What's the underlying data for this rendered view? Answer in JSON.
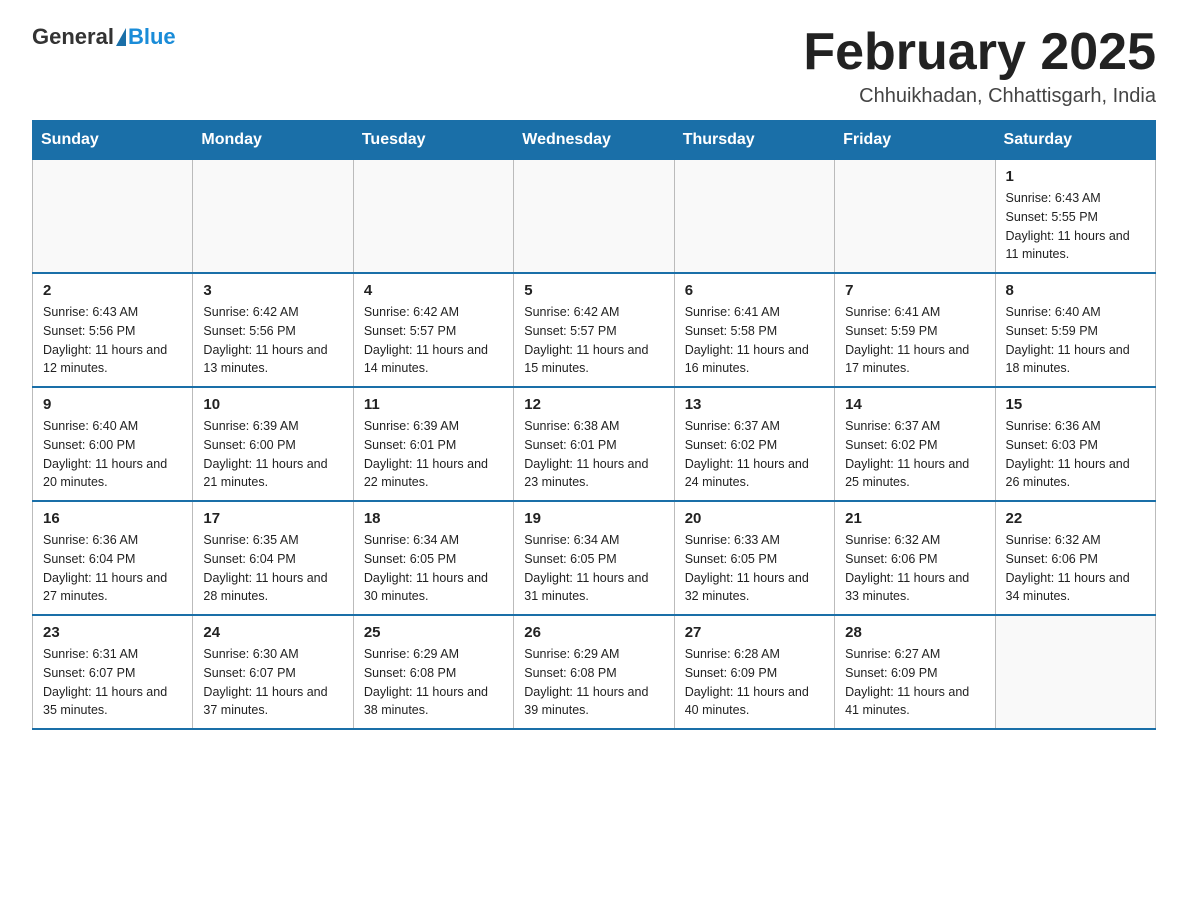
{
  "header": {
    "logo_general": "General",
    "logo_blue": "Blue",
    "month_title": "February 2025",
    "location": "Chhuikhadan, Chhattisgarh, India"
  },
  "days_of_week": [
    "Sunday",
    "Monday",
    "Tuesday",
    "Wednesday",
    "Thursday",
    "Friday",
    "Saturday"
  ],
  "weeks": [
    [
      {
        "day": "",
        "info": ""
      },
      {
        "day": "",
        "info": ""
      },
      {
        "day": "",
        "info": ""
      },
      {
        "day": "",
        "info": ""
      },
      {
        "day": "",
        "info": ""
      },
      {
        "day": "",
        "info": ""
      },
      {
        "day": "1",
        "info": "Sunrise: 6:43 AM\nSunset: 5:55 PM\nDaylight: 11 hours and 11 minutes."
      }
    ],
    [
      {
        "day": "2",
        "info": "Sunrise: 6:43 AM\nSunset: 5:56 PM\nDaylight: 11 hours and 12 minutes."
      },
      {
        "day": "3",
        "info": "Sunrise: 6:42 AM\nSunset: 5:56 PM\nDaylight: 11 hours and 13 minutes."
      },
      {
        "day": "4",
        "info": "Sunrise: 6:42 AM\nSunset: 5:57 PM\nDaylight: 11 hours and 14 minutes."
      },
      {
        "day": "5",
        "info": "Sunrise: 6:42 AM\nSunset: 5:57 PM\nDaylight: 11 hours and 15 minutes."
      },
      {
        "day": "6",
        "info": "Sunrise: 6:41 AM\nSunset: 5:58 PM\nDaylight: 11 hours and 16 minutes."
      },
      {
        "day": "7",
        "info": "Sunrise: 6:41 AM\nSunset: 5:59 PM\nDaylight: 11 hours and 17 minutes."
      },
      {
        "day": "8",
        "info": "Sunrise: 6:40 AM\nSunset: 5:59 PM\nDaylight: 11 hours and 18 minutes."
      }
    ],
    [
      {
        "day": "9",
        "info": "Sunrise: 6:40 AM\nSunset: 6:00 PM\nDaylight: 11 hours and 20 minutes."
      },
      {
        "day": "10",
        "info": "Sunrise: 6:39 AM\nSunset: 6:00 PM\nDaylight: 11 hours and 21 minutes."
      },
      {
        "day": "11",
        "info": "Sunrise: 6:39 AM\nSunset: 6:01 PM\nDaylight: 11 hours and 22 minutes."
      },
      {
        "day": "12",
        "info": "Sunrise: 6:38 AM\nSunset: 6:01 PM\nDaylight: 11 hours and 23 minutes."
      },
      {
        "day": "13",
        "info": "Sunrise: 6:37 AM\nSunset: 6:02 PM\nDaylight: 11 hours and 24 minutes."
      },
      {
        "day": "14",
        "info": "Sunrise: 6:37 AM\nSunset: 6:02 PM\nDaylight: 11 hours and 25 minutes."
      },
      {
        "day": "15",
        "info": "Sunrise: 6:36 AM\nSunset: 6:03 PM\nDaylight: 11 hours and 26 minutes."
      }
    ],
    [
      {
        "day": "16",
        "info": "Sunrise: 6:36 AM\nSunset: 6:04 PM\nDaylight: 11 hours and 27 minutes."
      },
      {
        "day": "17",
        "info": "Sunrise: 6:35 AM\nSunset: 6:04 PM\nDaylight: 11 hours and 28 minutes."
      },
      {
        "day": "18",
        "info": "Sunrise: 6:34 AM\nSunset: 6:05 PM\nDaylight: 11 hours and 30 minutes."
      },
      {
        "day": "19",
        "info": "Sunrise: 6:34 AM\nSunset: 6:05 PM\nDaylight: 11 hours and 31 minutes."
      },
      {
        "day": "20",
        "info": "Sunrise: 6:33 AM\nSunset: 6:05 PM\nDaylight: 11 hours and 32 minutes."
      },
      {
        "day": "21",
        "info": "Sunrise: 6:32 AM\nSunset: 6:06 PM\nDaylight: 11 hours and 33 minutes."
      },
      {
        "day": "22",
        "info": "Sunrise: 6:32 AM\nSunset: 6:06 PM\nDaylight: 11 hours and 34 minutes."
      }
    ],
    [
      {
        "day": "23",
        "info": "Sunrise: 6:31 AM\nSunset: 6:07 PM\nDaylight: 11 hours and 35 minutes."
      },
      {
        "day": "24",
        "info": "Sunrise: 6:30 AM\nSunset: 6:07 PM\nDaylight: 11 hours and 37 minutes."
      },
      {
        "day": "25",
        "info": "Sunrise: 6:29 AM\nSunset: 6:08 PM\nDaylight: 11 hours and 38 minutes."
      },
      {
        "day": "26",
        "info": "Sunrise: 6:29 AM\nSunset: 6:08 PM\nDaylight: 11 hours and 39 minutes."
      },
      {
        "day": "27",
        "info": "Sunrise: 6:28 AM\nSunset: 6:09 PM\nDaylight: 11 hours and 40 minutes."
      },
      {
        "day": "28",
        "info": "Sunrise: 6:27 AM\nSunset: 6:09 PM\nDaylight: 11 hours and 41 minutes."
      },
      {
        "day": "",
        "info": ""
      }
    ]
  ]
}
